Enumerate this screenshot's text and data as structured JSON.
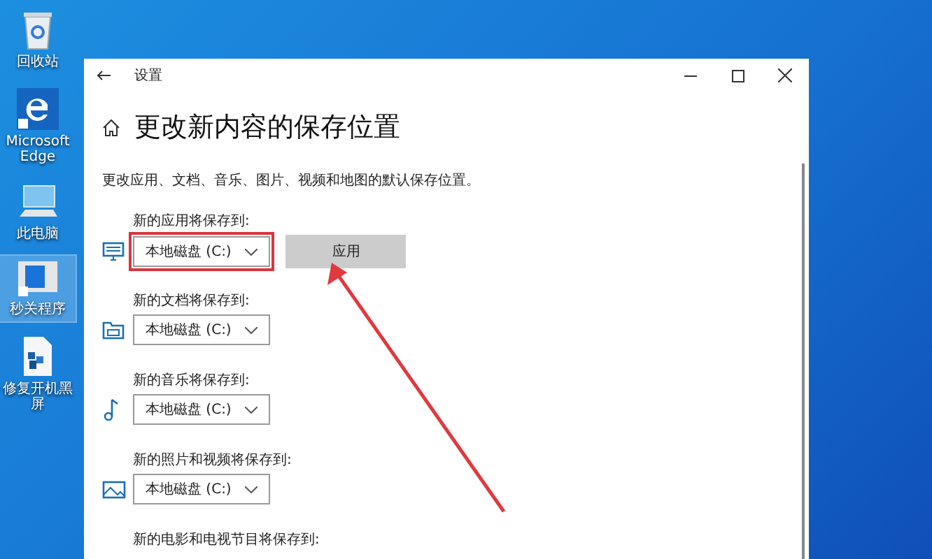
{
  "desktop_icons": [
    {
      "kind": "recycle",
      "label": "回收站",
      "selected": false
    },
    {
      "kind": "browser",
      "label": "Microsoft Edge",
      "selected": false
    },
    {
      "kind": "computer",
      "label": "此电脑",
      "selected": false
    },
    {
      "kind": "app",
      "label": "秒关程序",
      "selected": true
    },
    {
      "kind": "file",
      "label": "修复开机黑屏",
      "selected": false
    }
  ],
  "window": {
    "title": "设置",
    "heading": "更改新内容的保存位置",
    "description": "更改应用、文档、音乐、图片、视频和地图的默认保存位置。",
    "sections": [
      {
        "kind": "apps",
        "label": "新的应用将保存到:",
        "drive": "本地磁盘 (C:)",
        "highlighted": true,
        "apply_button": "应用"
      },
      {
        "kind": "documents",
        "label": "新的文档将保存到:",
        "drive": "本地磁盘 (C:)",
        "highlighted": false
      },
      {
        "kind": "music",
        "label": "新的音乐将保存到:",
        "drive": "本地磁盘 (C:)",
        "highlighted": false
      },
      {
        "kind": "photos",
        "label": "新的照片和视频将保存到:",
        "drive": "本地磁盘 (C:)",
        "highlighted": false
      },
      {
        "label": "新的电影和电视节目将保存到:"
      }
    ]
  }
}
